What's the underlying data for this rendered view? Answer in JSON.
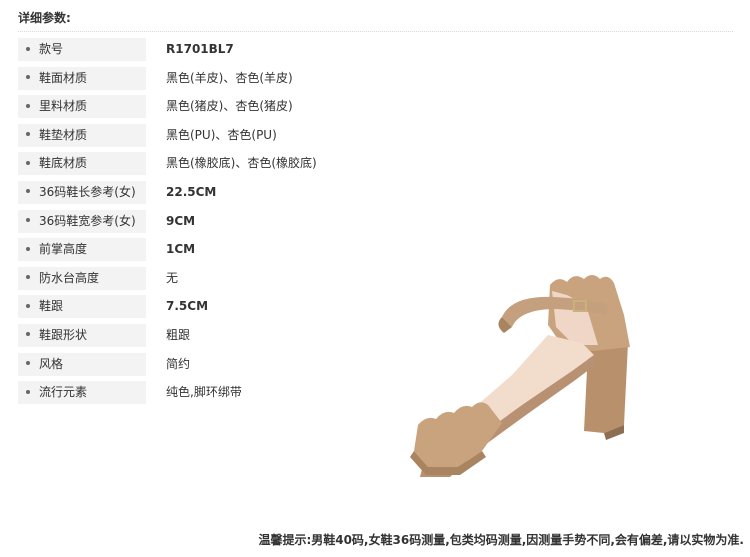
{
  "header": {
    "title": "详细参数:"
  },
  "specs": [
    {
      "label": "款号",
      "value": "R1701BL7"
    },
    {
      "label": "鞋面材质",
      "value": "黑色(羊皮)、杏色(羊皮)"
    },
    {
      "label": "里料材质",
      "value": "黑色(猪皮)、杏色(猪皮)"
    },
    {
      "label": "鞋垫材质",
      "value": "黑色(PU)、杏色(PU)"
    },
    {
      "label": "鞋底材质",
      "value": "黑色(橡胶底)、杏色(橡胶底)"
    },
    {
      "label": "36码鞋长参考(女)",
      "value": "22.5CM"
    },
    {
      "label": "36码鞋宽参考(女)",
      "value": "9CM"
    },
    {
      "label": "前掌高度",
      "value": "1CM"
    },
    {
      "label": "防水台高度",
      "value": "无"
    },
    {
      "label": "鞋跟",
      "value": "7.5CM"
    },
    {
      "label": "鞋跟形状",
      "value": "粗跟"
    },
    {
      "label": "风格",
      "value": "简约"
    },
    {
      "label": "流行元素",
      "value": "纯色,脚环绑带"
    }
  ],
  "footer": {
    "note": "温馨提示:男鞋40码,女鞋36码测量,包类均码测量,因测量手势不同,会有偏差,请以实物为准."
  },
  "colors": {
    "suede": "#c9a27e",
    "suede_dark": "#a98460",
    "lining": "#f0d6c6",
    "label_bg": "#f3f3f3"
  }
}
